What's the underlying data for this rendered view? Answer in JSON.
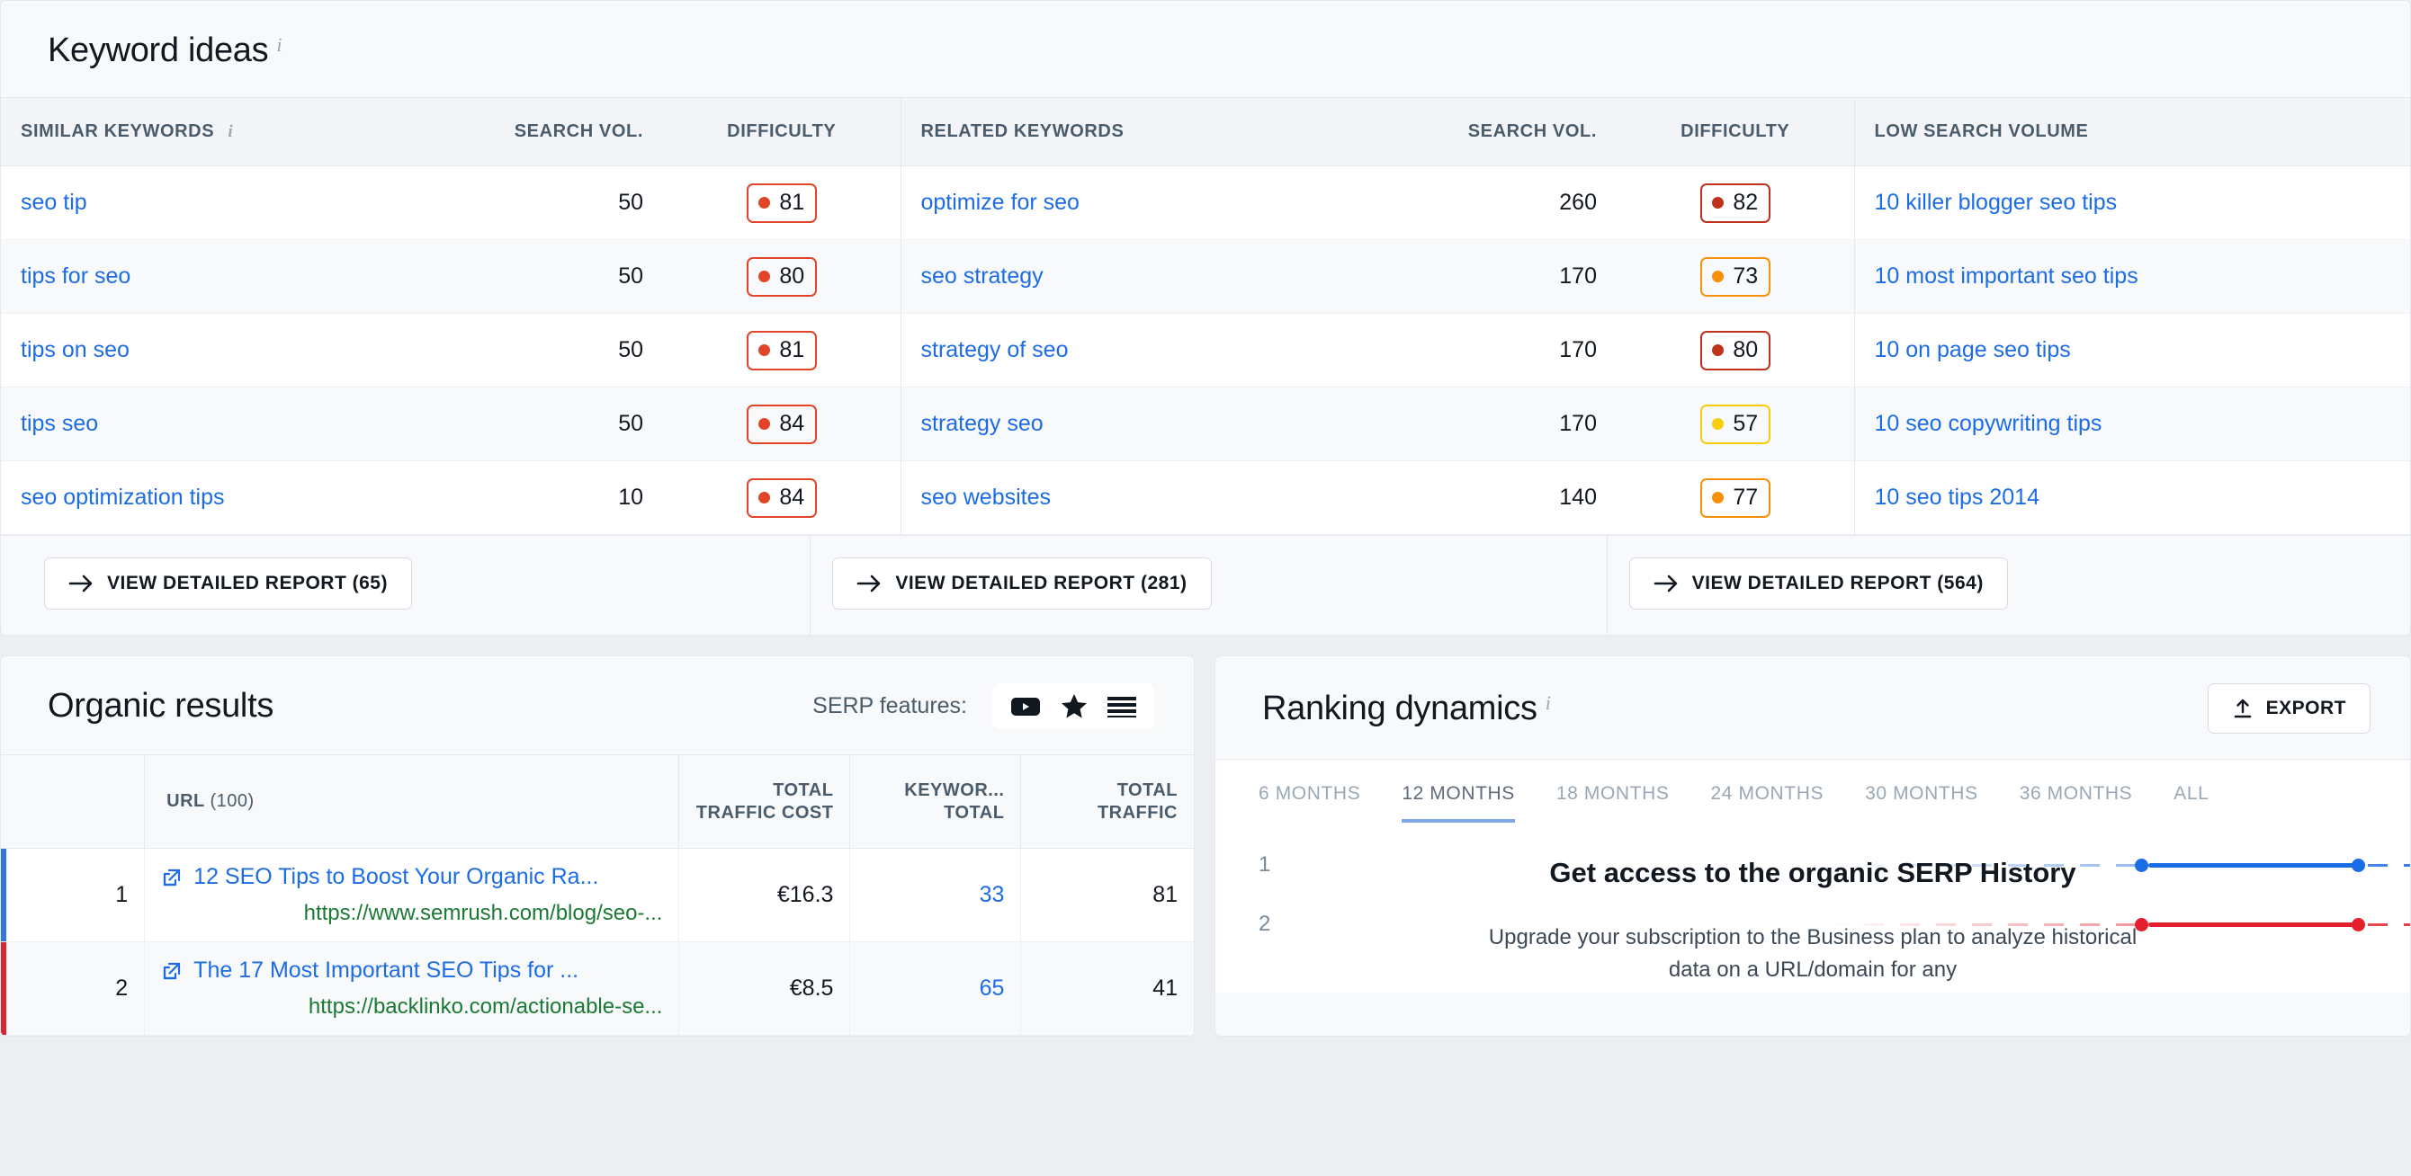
{
  "keyword_ideas": {
    "title": "Keyword ideas",
    "info_icon": "info-icon",
    "columns": {
      "similar_keywords": "SIMILAR KEYWORDS",
      "search_vol_1": "SEARCH VOL.",
      "difficulty_1": "DIFFICULTY",
      "related_keywords": "RELATED KEYWORDS",
      "search_vol_2": "SEARCH VOL.",
      "difficulty_2": "DIFFICULTY",
      "low_search_volume": "LOW SEARCH VOLUME"
    },
    "rows": [
      {
        "similar": "seo tip",
        "vol1": "50",
        "diff1": "81",
        "diff1_color": "#e0452a",
        "related": "optimize for seo",
        "vol2": "260",
        "diff2": "82",
        "diff2_color": "#c0311c",
        "low": "10 killer blogger seo tips"
      },
      {
        "similar": "tips for seo",
        "vol1": "50",
        "diff1": "80",
        "diff1_color": "#e0452a",
        "related": "seo strategy",
        "vol2": "170",
        "diff2": "73",
        "diff2_color": "#f79009",
        "low": "10 most important seo tips"
      },
      {
        "similar": "tips on seo",
        "vol1": "50",
        "diff1": "81",
        "diff1_color": "#e0452a",
        "related": "strategy of seo",
        "vol2": "170",
        "diff2": "80",
        "diff2_color": "#c0311c",
        "low": "10 on page seo tips"
      },
      {
        "similar": "tips seo",
        "vol1": "50",
        "diff1": "84",
        "diff1_color": "#e0452a",
        "related": "strategy seo",
        "vol2": "170",
        "diff2": "57",
        "diff2_color": "#f5cf0b",
        "low": "10 seo copywriting tips"
      },
      {
        "similar": "seo optimization tips",
        "vol1": "10",
        "diff1": "84",
        "diff1_color": "#e0452a",
        "related": "seo websites",
        "vol2": "140",
        "diff2": "77",
        "diff2_color": "#f79009",
        "low": "10 seo tips 2014"
      }
    ],
    "footer_buttons": [
      {
        "label": "VIEW DETAILED REPORT (65)"
      },
      {
        "label": "VIEW DETAILED REPORT (281)"
      },
      {
        "label": "VIEW DETAILED REPORT (564)"
      }
    ]
  },
  "organic_results": {
    "title": "Organic results",
    "serp_features_label": "SERP features:",
    "serp_icons": [
      "video-icon",
      "star-icon",
      "list-icon"
    ],
    "columns": {
      "rank": "",
      "url": "URL",
      "url_count": "(100)",
      "total_traffic_cost": "TOTAL TRAFFIC COST",
      "keywords_total_l1": "KEYWOR...",
      "keywords_total_l2": "TOTAL",
      "total_traffic_l1": "TOTAL",
      "total_traffic_l2": "TRAFFIC"
    },
    "rows": [
      {
        "rank": "1",
        "accent": "#3477d8",
        "title": "12 SEO Tips to Boost Your Organic Ra...",
        "url": "https://www.semrush.com/blog/seo-...",
        "cost": "€16.3",
        "keywords": "33",
        "traffic": "81"
      },
      {
        "rank": "2",
        "accent": "#d72638",
        "title": "The 17 Most Important SEO Tips for ...",
        "url": "https://backlinko.com/actionable-se...",
        "cost": "€8.5",
        "keywords": "65",
        "traffic": "41"
      }
    ]
  },
  "ranking_dynamics": {
    "title": "Ranking dynamics",
    "info_icon": "info-icon",
    "export_label": "EXPORT",
    "export_icon": "upload-icon",
    "tabs": [
      {
        "label": "6 MONTHS",
        "active": false
      },
      {
        "label": "12 MONTHS",
        "active": true
      },
      {
        "label": "18 MONTHS",
        "active": false
      },
      {
        "label": "24 MONTHS",
        "active": false
      },
      {
        "label": "30 MONTHS",
        "active": false
      },
      {
        "label": "36 MONTHS",
        "active": false
      },
      {
        "label": "ALL",
        "active": false
      }
    ],
    "rows": [
      {
        "rank": "1",
        "color": "#1c6ce5"
      },
      {
        "rank": "2",
        "color": "#e5202e"
      }
    ],
    "promo": {
      "title": "Get access to the organic SERP History",
      "text": "Upgrade your subscription to the Business plan to analyze historical data on a URL/domain for any"
    }
  }
}
